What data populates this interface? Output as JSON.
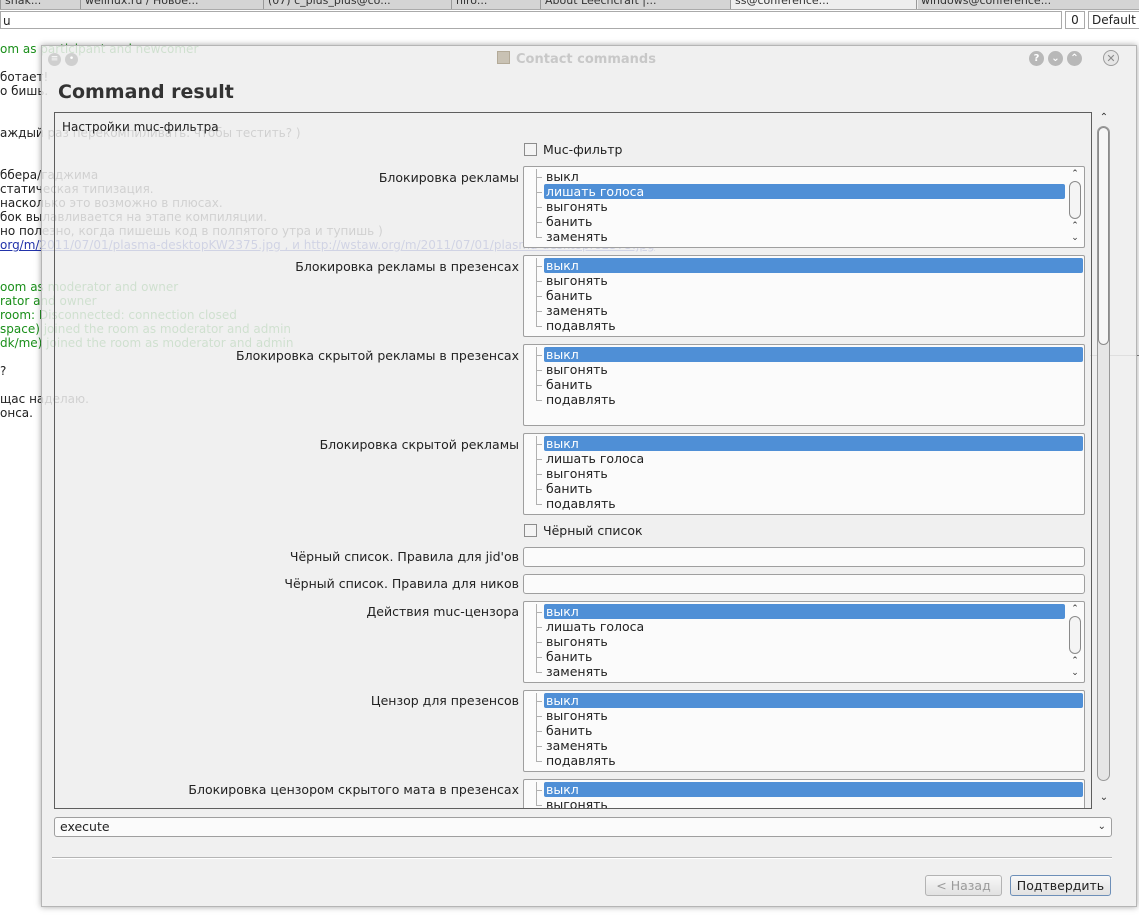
{
  "background": {
    "tabs": [
      "snak...",
      "welinux.ru / Новое...",
      "(07) c_plus_plus@co...",
      "niro...",
      "About Leechcraft |...",
      "ss@conference...",
      "windows@conference..."
    ],
    "topic_value": "u",
    "count": "0",
    "combo_value": "Default",
    "chat_lines": [
      {
        "text": "om as participant and newcomer",
        "style": "green"
      },
      {
        "text": "ботает!",
        "style": "normal"
      },
      {
        "text": "о бишь.",
        "style": "normal"
      },
      {
        "text": "аждый раз перекомпиливать. чтобы тестить? )",
        "style": "normal"
      },
      {
        "text": "ббера/гаджима",
        "style": "normal"
      },
      {
        "text": "статическая типизация.",
        "style": "normal"
      },
      {
        "text": "насколько это возможно в плюсах.",
        "style": "normal"
      },
      {
        "text": "бок вылавливается на этапе компиляции.",
        "style": "normal"
      },
      {
        "text": "но полезно, когда пишешь код в полпятого утра и тупишь )",
        "style": "normal"
      },
      {
        "text": "org/m/2011/07/01/plasma-desktopKW2375.jpg , и http://wstaw.org/m/2011/07/01/plasma-desktopro2375.jpg",
        "style": "link"
      },
      {
        "text": "oom as moderator and owner",
        "style": "green"
      },
      {
        "text": "rator and owner",
        "style": "green"
      },
      {
        "text": "room: Disconnected: connection closed",
        "style": "green"
      },
      {
        "text": "space) joined the room as moderator and admin",
        "style": "green"
      },
      {
        "text": "dk/me) joined the room as moderator and admin",
        "style": "green"
      },
      {
        "text": "?",
        "style": "normal"
      },
      {
        "text": "щас наделаю.",
        "style": "normal"
      },
      {
        "text": "онса.",
        "style": "normal"
      }
    ]
  },
  "dialog": {
    "title": "Contact commands",
    "heading": "Command result",
    "form_title": "Настройки muc-фильтра",
    "fields": [
      {
        "type": "checkbox",
        "label": "Muc-фильтр"
      },
      {
        "type": "list",
        "label": "Блокировка рекламы",
        "items": [
          "выкл",
          "лишать голоса",
          "выгонять",
          "банить",
          "заменять"
        ],
        "selected": "лишать голоса",
        "scrollbar": true
      },
      {
        "type": "list",
        "label": "Блокировка рекламы в презенсах",
        "items": [
          "выкл",
          "выгонять",
          "банить",
          "заменять",
          "подавлять"
        ],
        "selected": "выкл",
        "scrollbar": false
      },
      {
        "type": "list",
        "label": "Блокировка скрытой рекламы в презенсах",
        "items": [
          "выкл",
          "выгонять",
          "банить",
          "подавлять"
        ],
        "selected": "выкл",
        "scrollbar": false
      },
      {
        "type": "list",
        "label": "Блокировка скрытой рекламы",
        "items": [
          "выкл",
          "лишать голоса",
          "выгонять",
          "банить",
          "подавлять"
        ],
        "selected": "выкл",
        "scrollbar": false
      },
      {
        "type": "checkbox",
        "label": "Чёрный список"
      },
      {
        "type": "text",
        "label": "Чёрный список. Правила для jid'ов",
        "value": ""
      },
      {
        "type": "text",
        "label": "Чёрный список. Правила для ников",
        "value": ""
      },
      {
        "type": "list",
        "label": "Действия muc-цензора",
        "items": [
          "выкл",
          "лишать голоса",
          "выгонять",
          "банить",
          "заменять"
        ],
        "selected": "выкл",
        "scrollbar": true
      },
      {
        "type": "list",
        "label": "Цензор для презенсов",
        "items": [
          "выкл",
          "выгонять",
          "банить",
          "заменять",
          "подавлять"
        ],
        "selected": "выкл",
        "scrollbar": false
      },
      {
        "type": "list",
        "label": "Блокировка цензором скрытого мата в презенсах",
        "items": [
          "выкл",
          "выгонять"
        ],
        "selected": "выкл",
        "scrollbar": false
      }
    ],
    "action": "execute",
    "buttons": {
      "back": "< Назад",
      "confirm": "Подтвердить"
    }
  }
}
